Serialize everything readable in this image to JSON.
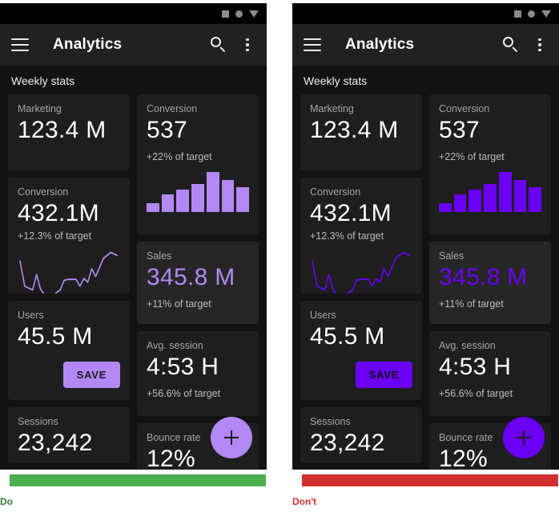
{
  "colors": {
    "screen_bg": "#121212",
    "card_bg": "#1e1e1e",
    "card_raised_bg": "#262626",
    "appbar_bg": "#212121",
    "left_accent": "#b388f4",
    "right_accent": "#6a00f4",
    "do_green": "#4caf50",
    "dont_red": "#d32f2f"
  },
  "panels": [
    {
      "id": "do",
      "verdict": {
        "label": "Do",
        "color": "#4caf50"
      },
      "accent": "#b388f4",
      "statusbar": {
        "icons": [
          "square-icon",
          "circle-icon",
          "triangle-down-icon"
        ]
      },
      "appbar": {
        "menu_icon": "hamburger-icon",
        "title": "Analytics",
        "search_icon": "search-icon",
        "overflow_icon": "more-vert-icon"
      },
      "section_title": "Weekly stats",
      "fab": {
        "icon": "plus-icon",
        "label": "+"
      },
      "cards": {
        "marketing": {
          "label": "Marketing",
          "value": "123.4 M"
        },
        "conversion_chart": {
          "label": "Conversion",
          "value": "537",
          "sub": "+22% of target"
        },
        "conversion_line": {
          "label": "Conversion",
          "value": "432.1M",
          "sub": "+12.3% of target"
        },
        "sales": {
          "label": "Sales",
          "value": "345.8 M",
          "sub": "+11% of target"
        },
        "users": {
          "label": "Users",
          "value": "45.5 M",
          "save_label": "SAVE"
        },
        "avg_session": {
          "label": "Avg. session",
          "value": "4:53 H",
          "sub": "+56.6% of target"
        },
        "sessions": {
          "label": "Sessions",
          "value": "23,242"
        },
        "bounce_rate": {
          "label": "Bounce rate",
          "value": "12%"
        }
      }
    },
    {
      "id": "dont",
      "verdict": {
        "label": "Don't",
        "color": "#d32f2f"
      },
      "accent": "#6a00f4",
      "statusbar": {
        "icons": [
          "square-icon",
          "circle-icon",
          "triangle-down-icon"
        ]
      },
      "appbar": {
        "menu_icon": "hamburger-icon",
        "title": "Analytics",
        "search_icon": "search-icon",
        "overflow_icon": "more-vert-icon"
      },
      "section_title": "Weekly stats",
      "fab": {
        "icon": "plus-icon",
        "label": "+"
      },
      "cards": {
        "marketing": {
          "label": "Marketing",
          "value": "123.4 M"
        },
        "conversion_chart": {
          "label": "Conversion",
          "value": "537",
          "sub": "+22% of target"
        },
        "conversion_line": {
          "label": "Conversion",
          "value": "432.1M",
          "sub": "+12.3% of target"
        },
        "sales": {
          "label": "Sales",
          "value": "345.8 M",
          "sub": "+11% of target"
        },
        "users": {
          "label": "Users",
          "value": "45.5 M",
          "save_label": "SAVE"
        },
        "avg_session": {
          "label": "Avg. session",
          "value": "4:53 H",
          "sub": "+56.6% of target"
        },
        "sessions": {
          "label": "Sessions",
          "value": "23,242"
        },
        "bounce_rate": {
          "label": "Bounce rate",
          "value": "12%"
        }
      }
    }
  ],
  "chart_data": [
    {
      "type": "bar",
      "title": "Conversion",
      "categories": [
        "1",
        "2",
        "3",
        "4",
        "5",
        "6",
        "7"
      ],
      "values": [
        22,
        44,
        56,
        70,
        100,
        80,
        62
      ],
      "xlabel": "",
      "ylabel": "",
      "ylim": [
        0,
        100
      ],
      "grid": false,
      "legend": "none",
      "annotation": "+22% of target"
    },
    {
      "type": "line",
      "title": "Conversion",
      "x": [
        0,
        1,
        2,
        3,
        4,
        5,
        6,
        7,
        8,
        9,
        10,
        11,
        12,
        13,
        14,
        15,
        16,
        17,
        18,
        19,
        20,
        21,
        22
      ],
      "values": [
        72,
        28,
        22,
        18,
        48,
        20,
        14,
        12,
        8,
        18,
        22,
        38,
        40,
        40,
        40,
        28,
        42,
        36,
        58,
        46,
        76,
        86,
        82
      ],
      "xlabel": "",
      "ylabel": "",
      "ylim": [
        0,
        100
      ],
      "grid": false,
      "legend": "none",
      "annotation": "+12.3% of target"
    }
  ]
}
